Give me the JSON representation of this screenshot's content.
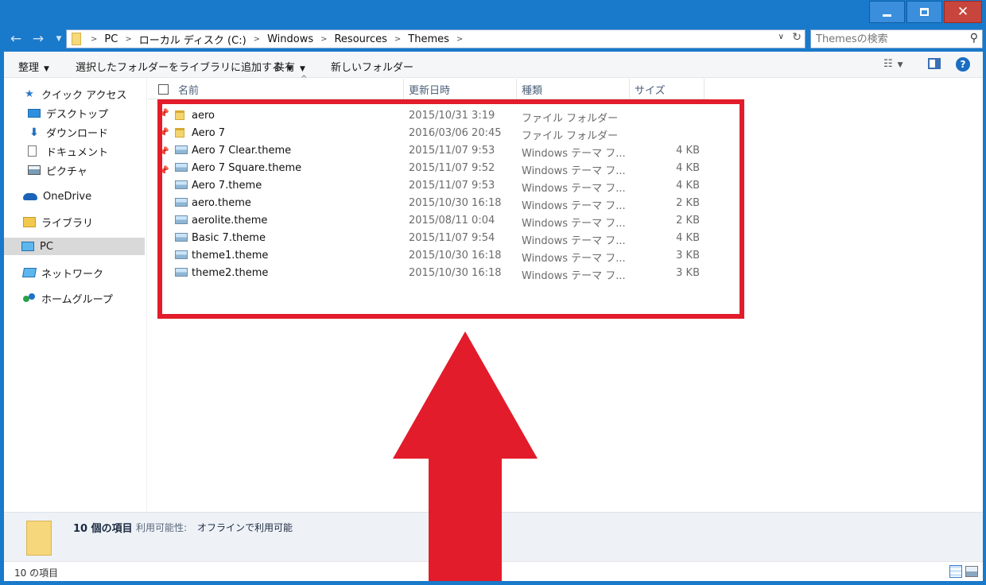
{
  "window": {
    "controls": {
      "minimize": "minimize",
      "maximize": "maximize",
      "close": "✕"
    }
  },
  "address_bar": {
    "crumbs": [
      "PC",
      "ローカル ディスク (C:)",
      "Windows",
      "Resources",
      "Themes"
    ],
    "search_placeholder": "Themesの検索"
  },
  "toolbar": {
    "organize": "整理",
    "add_to_library": "選択したフォルダーをライブラリに追加する",
    "share": "共有",
    "new_folder": "新しいフォルダー"
  },
  "nav": {
    "quick_access": "クイック アクセス",
    "desktop": "デスクトップ",
    "downloads": "ダウンロード",
    "documents": "ドキュメント",
    "pictures": "ピクチャ",
    "onedrive": "OneDrive",
    "libraries": "ライブラリ",
    "pc": "PC",
    "network": "ネットワーク",
    "homegroup": "ホームグループ"
  },
  "columns": {
    "name": "名前",
    "date": "更新日時",
    "type": "種類",
    "size": "サイズ"
  },
  "files": [
    {
      "name": "aero",
      "date": "2015/10/31 3:19",
      "type": "ファイル フォルダー",
      "size": "",
      "kind": "folder"
    },
    {
      "name": "Aero 7",
      "date": "2016/03/06 20:45",
      "type": "ファイル フォルダー",
      "size": "",
      "kind": "folder"
    },
    {
      "name": "Aero 7 Clear.theme",
      "date": "2015/11/07 9:53",
      "type": "Windows テーマ フ...",
      "size": "4 KB",
      "kind": "theme"
    },
    {
      "name": "Aero 7 Square.theme",
      "date": "2015/11/07 9:52",
      "type": "Windows テーマ フ...",
      "size": "4 KB",
      "kind": "theme"
    },
    {
      "name": "Aero 7.theme",
      "date": "2015/11/07 9:53",
      "type": "Windows テーマ フ...",
      "size": "4 KB",
      "kind": "theme"
    },
    {
      "name": "aero.theme",
      "date": "2015/10/30 16:18",
      "type": "Windows テーマ フ...",
      "size": "2 KB",
      "kind": "theme"
    },
    {
      "name": "aerolite.theme",
      "date": "2015/08/11 0:04",
      "type": "Windows テーマ フ...",
      "size": "2 KB",
      "kind": "theme"
    },
    {
      "name": "Basic 7.theme",
      "date": "2015/11/07 9:54",
      "type": "Windows テーマ フ...",
      "size": "4 KB",
      "kind": "theme"
    },
    {
      "name": "theme1.theme",
      "date": "2015/10/30 16:18",
      "type": "Windows テーマ フ...",
      "size": "3 KB",
      "kind": "theme"
    },
    {
      "name": "theme2.theme",
      "date": "2015/10/30 16:18",
      "type": "Windows テーマ フ...",
      "size": "3 KB",
      "kind": "theme"
    }
  ],
  "details": {
    "count": "10 個の項目",
    "availability_label": "利用可能性:",
    "availability_value": "オフラインで利用可能"
  },
  "status": {
    "item_count": "10 の項目"
  },
  "annotation": {
    "color": "#e21c2a"
  }
}
